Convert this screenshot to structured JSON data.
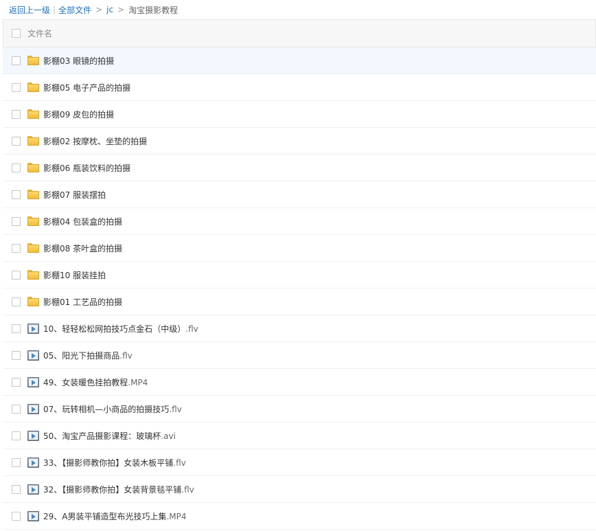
{
  "breadcrumb": {
    "back": "返回上一级",
    "bar_sep": "|",
    "all_files": "全部文件",
    "arrow_sep": ">",
    "folder": "jc",
    "current": "淘宝摄影教程"
  },
  "header": {
    "column_name": "文件名"
  },
  "rows": [
    {
      "name": "影棚03 眼镜的拍摄",
      "ext": "",
      "type": "folder"
    },
    {
      "name": "影棚05 电子产品的拍摄",
      "ext": "",
      "type": "folder"
    },
    {
      "name": "影棚09 皮包的拍摄",
      "ext": "",
      "type": "folder"
    },
    {
      "name": "影棚02 按摩枕、坐垫的拍摄",
      "ext": "",
      "type": "folder"
    },
    {
      "name": "影棚06 瓶装饮料的拍摄",
      "ext": "",
      "type": "folder"
    },
    {
      "name": "影棚07 服装摆拍",
      "ext": "",
      "type": "folder"
    },
    {
      "name": "影棚04 包装盒的拍摄",
      "ext": "",
      "type": "folder"
    },
    {
      "name": "影棚08 茶叶盒的拍摄",
      "ext": "",
      "type": "folder"
    },
    {
      "name": "影棚10 服装挂拍",
      "ext": "",
      "type": "folder"
    },
    {
      "name": "影棚01 工艺品的拍摄",
      "ext": "",
      "type": "folder"
    },
    {
      "name": "10、轻轻松松网拍技巧点金石（中级）",
      "ext": ".flv",
      "type": "video"
    },
    {
      "name": "05、阳光下拍摄商品",
      "ext": ".flv",
      "type": "video"
    },
    {
      "name": "49、女装暖色挂拍教程",
      "ext": ".MP4",
      "type": "video"
    },
    {
      "name": "07、玩转相机—小商品的拍摄技巧",
      "ext": ".flv",
      "type": "video"
    },
    {
      "name": "50、淘宝产品摄影课程：玻璃杯",
      "ext": ".avi",
      "type": "video"
    },
    {
      "name": "33、【摄影师教你拍】女装木板平铺",
      "ext": ".flv",
      "type": "video"
    },
    {
      "name": "32、【摄影师教你拍】女装背景毯平铺",
      "ext": ".flv",
      "type": "video"
    },
    {
      "name": "29、A男装平铺造型布光技巧上集",
      "ext": ".MP4",
      "type": "video"
    }
  ],
  "icons": {
    "folder": "folder-icon",
    "video": "video-file-icon"
  },
  "colors": {
    "link": "#1e6fc6",
    "hover_row": "#f2f8fd",
    "folder": "#f2bd3c"
  }
}
